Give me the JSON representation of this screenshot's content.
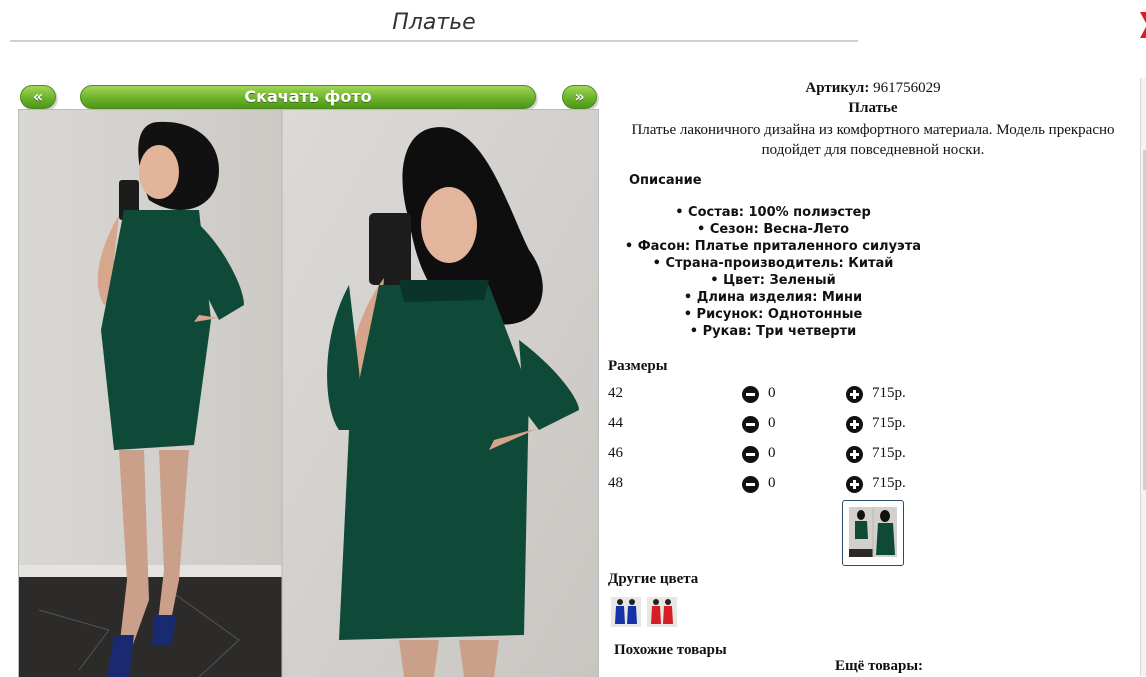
{
  "header": {
    "title": "Платье"
  },
  "gallery": {
    "prev_label": "«",
    "download_label": "Скачать фото",
    "next_label": "»"
  },
  "product": {
    "sku_label": "Артикул:",
    "sku_value": "961756029",
    "name": "Платье",
    "description": "Платье лаконичного дизайна из комфортного материала. Модель прекрасно подойдет для повседневной носки.",
    "specs_title": "Описание",
    "specs": [
      "Состав: 100% полиэстер",
      "Сезон: Весна-Лето",
      "Фасон: Платье приталенного силуэта",
      "Страна-производитель: Китай",
      "Цвет: Зеленый",
      "Длина изделия: Мини",
      "Рисунок: Однотонные",
      "Рукав: Три четверти"
    ]
  },
  "sizes": {
    "title": "Размеры",
    "rows": [
      {
        "size": "42",
        "qty": "0",
        "price": "715р."
      },
      {
        "size": "44",
        "qty": "0",
        "price": "715р."
      },
      {
        "size": "46",
        "qty": "0",
        "price": "715р."
      },
      {
        "size": "48",
        "qty": "0",
        "price": "715р."
      }
    ]
  },
  "other_colors": {
    "title": "Другие цвета",
    "items": [
      "blue",
      "red"
    ]
  },
  "similar": {
    "title": "Похожие товары"
  },
  "more": {
    "title": "Ещё товары:"
  },
  "colors": {
    "accent_green": "#6bb32b",
    "dress_green": "#0f4a39",
    "close_red": "#e01b24"
  },
  "icons": {
    "close": "close-icon",
    "minus": "minus-circle-icon",
    "plus": "plus-circle-icon"
  }
}
